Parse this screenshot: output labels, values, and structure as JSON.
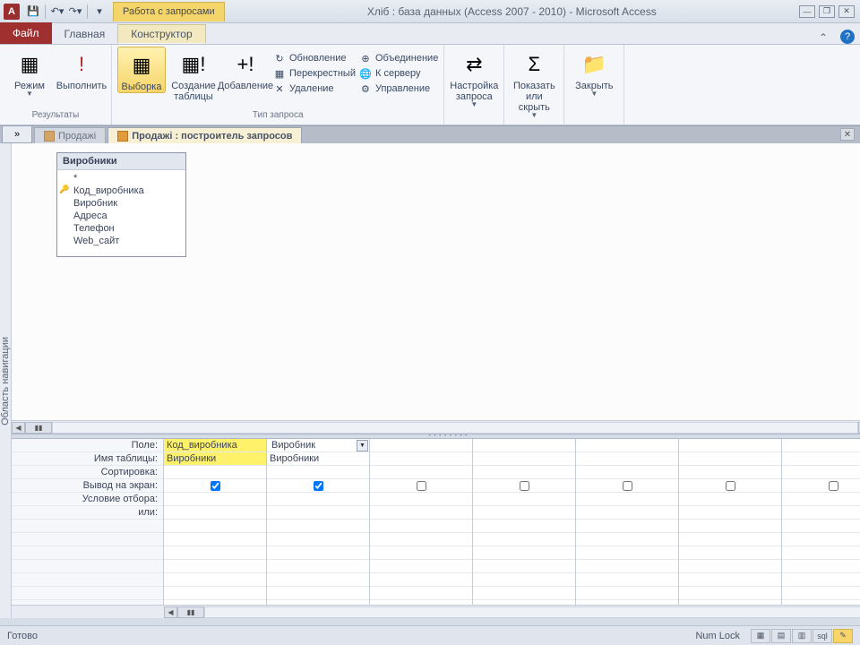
{
  "title": "Хліб : база данных (Access 2007 - 2010) - Microsoft Access",
  "context_tab": "Работа с запросами",
  "tabs": {
    "file": "Файл",
    "home": "Главная",
    "design": "Конструктор"
  },
  "ribbon": {
    "group1": {
      "label": "Результаты",
      "regim": "Режим",
      "run": "Выполнить"
    },
    "group2": {
      "label": "Тип запроса",
      "select": "Выборка",
      "maketable": "Создание\nтаблицы",
      "append": "Добавление",
      "update": "Обновление",
      "crosstab": "Перекрестный",
      "delete": "Удаление",
      "union": "Объединение",
      "passthrough": "К серверу",
      "datadef": "Управление"
    },
    "group3": {
      "setup": "Настройка\nзапроса"
    },
    "group4": {
      "show": "Показать\nили скрыть"
    },
    "group5": {
      "close": "Закрыть"
    }
  },
  "nav_pane": "Область навигации",
  "doc_tabs": {
    "tab1": "Продажі",
    "tab2": "Продажі : построитель запросов"
  },
  "table": {
    "name": "Виробники",
    "fields": [
      "*",
      "Код_виробника",
      "Виробник",
      "Адреса",
      "Телефон",
      "Web_сайт"
    ]
  },
  "grid_rows": {
    "field": "Поле:",
    "table": "Имя таблицы:",
    "sort": "Сортировка:",
    "show": "Вывод на экран:",
    "criteria": "Условие отбора:",
    "or": "или:"
  },
  "grid": {
    "c1_field": "Код_виробника",
    "c1_table": "Виробники",
    "c2_field": "Виробник",
    "c2_table": "Виробники"
  },
  "status": {
    "ready": "Готово",
    "numlock": "Num Lock"
  }
}
